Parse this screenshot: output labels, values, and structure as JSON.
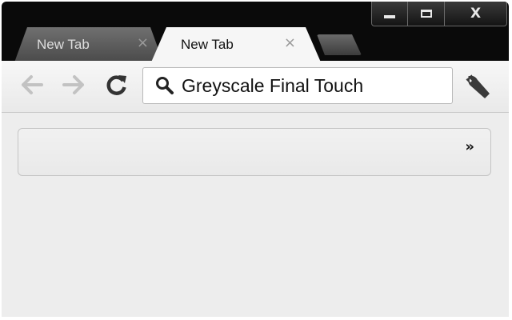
{
  "window_controls": {
    "minimize_icon": "minimize-icon",
    "maximize_icon": "maximize-icon",
    "close_label": "X"
  },
  "tabs": [
    {
      "label": "New Tab",
      "active": false,
      "close_glyph": "×"
    },
    {
      "label": "New Tab",
      "active": true,
      "close_glyph": "×"
    }
  ],
  "toolbar": {
    "back_icon": "back-arrow-icon",
    "forward_icon": "forward-arrow-icon",
    "reload_icon": "reload-icon",
    "omnibox_value": "Greyscale Final Touch",
    "search_icon": "search-icon",
    "wrench_icon": "wrench-icon"
  },
  "bookmarks_bar": {
    "overflow_glyph": "»"
  },
  "colors": {
    "frame": "#0a0a0a",
    "toolbar": "#efefef",
    "inactive_tab": "#5a5a5a",
    "active_tab": "#f6f6f6"
  }
}
